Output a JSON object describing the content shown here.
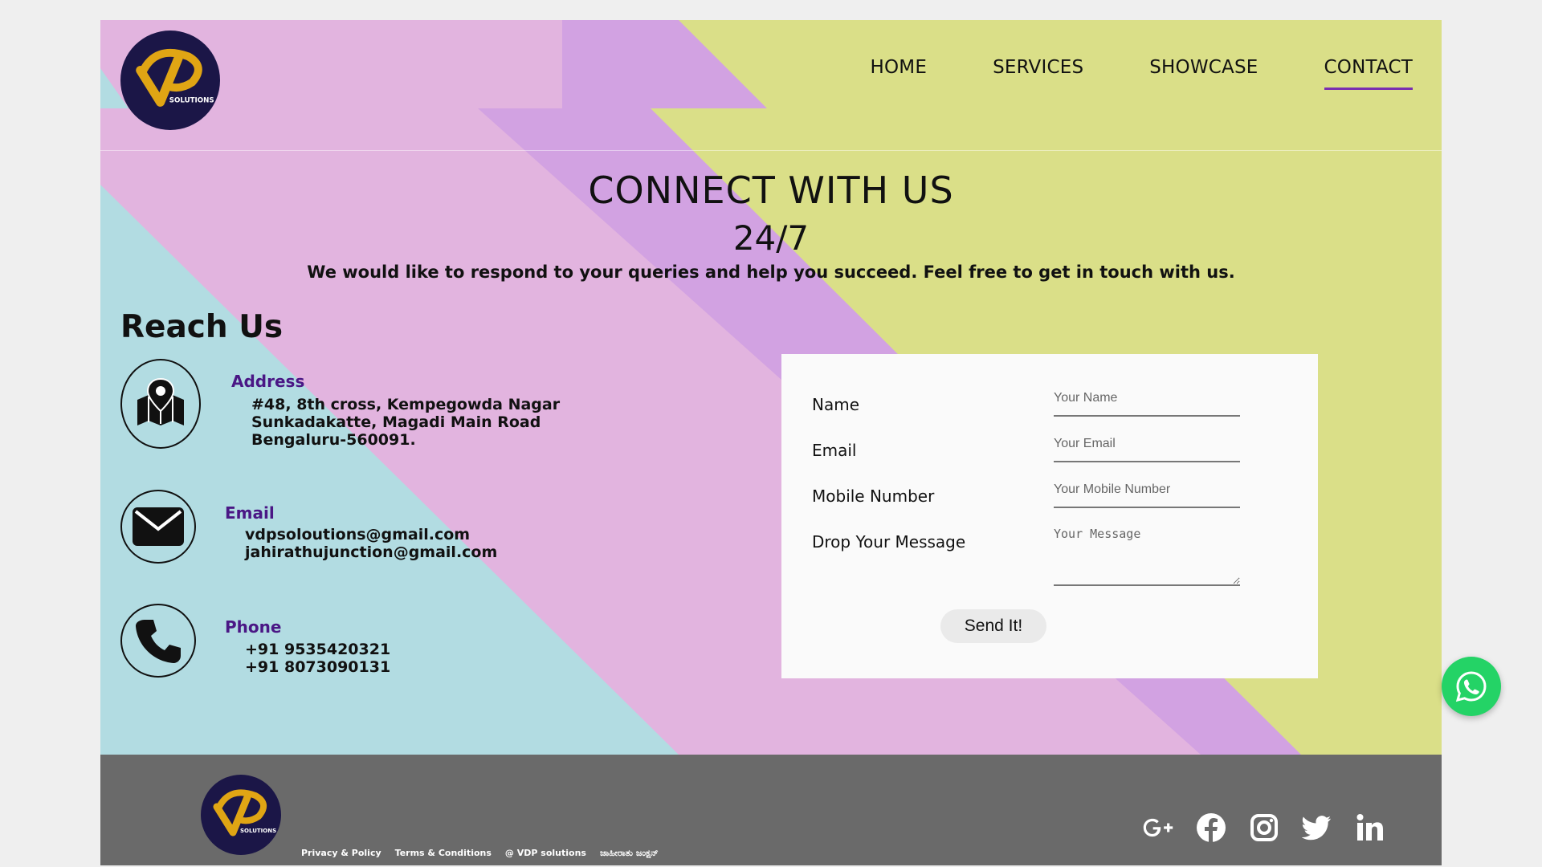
{
  "brand": {
    "logo_text": "SOLUTIONS"
  },
  "nav": {
    "items": [
      {
        "label": "HOME"
      },
      {
        "label": "SERVICES"
      },
      {
        "label": "SHOWCASE"
      },
      {
        "label": "CONTACT",
        "active": true
      }
    ]
  },
  "hero": {
    "title": "CONNECT WITH US",
    "subtitle": "24/7",
    "lead": "We would like to respond to your queries and help you succeed. Feel free to get in touch with us."
  },
  "reach": {
    "title": "Reach Us",
    "address": {
      "heading": "Address",
      "icon": "map-pin-icon",
      "lines": [
        "#48, 8th cross, Kempegowda Nagar",
        "Sunkadakatte, Magadi Main Road",
        "Bengaluru-560091."
      ]
    },
    "email": {
      "heading": "Email",
      "icon": "envelope-icon",
      "lines": [
        "vdpsoloutions@gmail.com",
        "jahirathujunction@gmail.com"
      ]
    },
    "phone": {
      "heading": "Phone",
      "icon": "phone-icon",
      "lines": [
        "+91 9535420321",
        "+91 8073090131"
      ]
    }
  },
  "form": {
    "fields": [
      {
        "label": "Name",
        "placeholder": "Your Name"
      },
      {
        "label": "Email",
        "placeholder": "Your Email"
      },
      {
        "label": "Mobile Number",
        "placeholder": "Your Mobile Number"
      },
      {
        "label": "Drop Your Message",
        "placeholder": "Your Message"
      }
    ],
    "submit_label": "Send It!"
  },
  "footer": {
    "links": [
      "Privacy & Policy",
      "Terms & Conditions",
      "@ VDP solutions",
      "ಜಾಹೀರಾತು ಜಂಕ್ಷನ್"
    ],
    "social": [
      "google-plus-icon",
      "facebook-icon",
      "instagram-icon",
      "twitter-icon",
      "linkedin-icon"
    ]
  },
  "floating": {
    "icon": "whatsapp-icon"
  },
  "colors": {
    "page_bg": "#efefef",
    "bg_pink": "#e2b4df",
    "bg_purple": "#d2a2e2",
    "bg_lime": "#dadf88",
    "bg_cyan": "#b2dce2",
    "footer_bg": "#6a6a6a",
    "accent_purple": "#4a1785",
    "logo_navy": "#1b1647",
    "logo_gold": "#e0a514",
    "whatsapp_green": "#24d366"
  }
}
